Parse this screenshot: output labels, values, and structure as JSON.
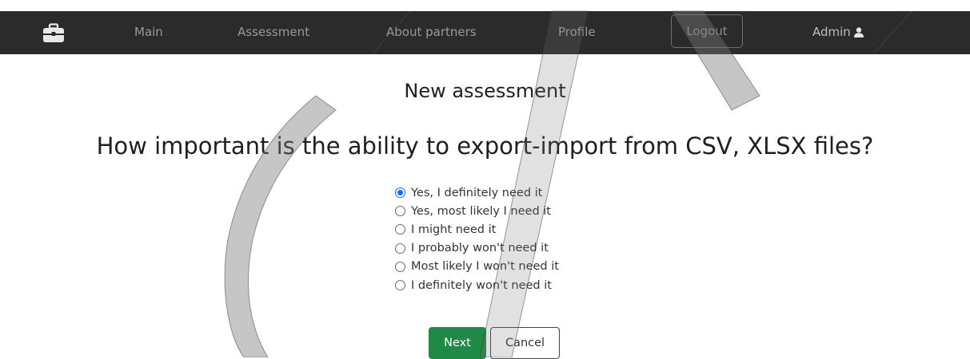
{
  "nav": {
    "brand_icon": "briefcase-icon",
    "items": [
      {
        "label": "Main"
      },
      {
        "label": "Assessment"
      },
      {
        "label": "About partners"
      },
      {
        "label": "Profile"
      }
    ],
    "logout_label": "Logout",
    "user_label": "Admin",
    "user_icon": "user-icon"
  },
  "page": {
    "title": "New assessment",
    "question": "How important is the ability to export-import from CSV, XLSX files?"
  },
  "options": [
    {
      "label": "Yes, I definitely need it",
      "checked": true
    },
    {
      "label": "Yes, most likely I need it",
      "checked": false
    },
    {
      "label": "I might need it",
      "checked": false
    },
    {
      "label": "I probably won't need it",
      "checked": false
    },
    {
      "label": "Most likely I won't need it",
      "checked": false
    },
    {
      "label": "I definitely won't need it",
      "checked": false
    }
  ],
  "buttons": {
    "next_label": "Next",
    "cancel_label": "Cancel"
  },
  "colors": {
    "navbar_bg": "#2b2b2b",
    "radio_checked": "#0d6efd",
    "next_button": "#1e8a46"
  }
}
